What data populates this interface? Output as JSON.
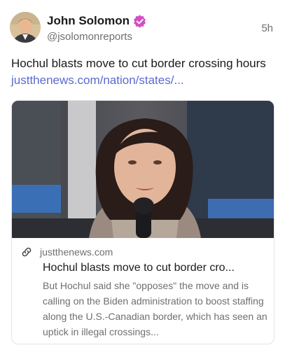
{
  "author": {
    "name": "John Solomon",
    "handle": "@jsolomonreports",
    "verified_color": "#d44fc4"
  },
  "post": {
    "time": "5h",
    "text": "Hochul blasts move to cut border crossing hours ",
    "link_text": "justthenews.com/nation/states/...",
    "link_color": "#5a6acf"
  },
  "link_card": {
    "icon": "link-icon",
    "domain": "justthenews.com",
    "title": "Hochul blasts move to cut border cro...",
    "description": "But Hochul said she \"opposes\" the move and is calling on the Biden administration to boost staffing along the U.S.-Canadian border, which has seen an uptick in illegal crossings..."
  }
}
